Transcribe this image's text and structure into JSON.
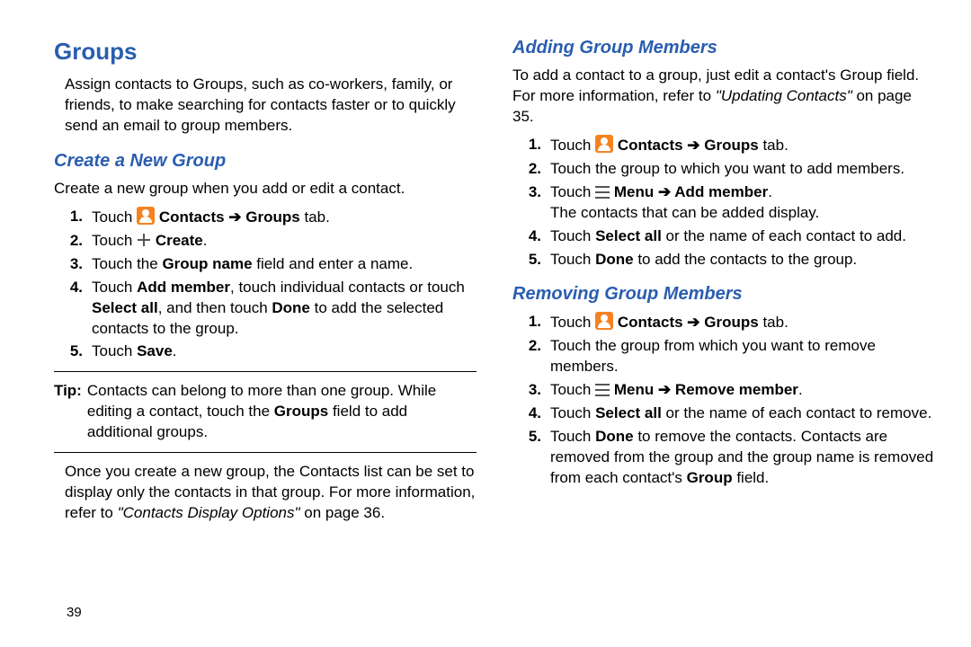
{
  "left": {
    "h1": "Groups",
    "intro": "Assign contacts to Groups, such as co-workers, family, or friends, to make searching for contacts faster or to quickly send an email to group members.",
    "h2a": "Create a New Group",
    "createIntro": "Create a new group when you add or edit a contact.",
    "step1_a": "Touch ",
    "step1_b": "Contacts",
    "step1_arrow": " ➔ ",
    "step1_c": "Groups",
    "step1_d": " tab.",
    "step2_a": "Touch ",
    "step2_b": "Create",
    "step2_c": ".",
    "step3_a": "Touch the ",
    "step3_b": "Group name",
    "step3_c": " field and enter a name.",
    "step4_a": "Touch ",
    "step4_b": "Add member",
    "step4_c": ", touch individual contacts or touch ",
    "step4_d": "Select all",
    "step4_e": ", and then touch ",
    "step4_f": "Done",
    "step4_g": " to add the selected contacts to the group.",
    "step5_a": "Touch ",
    "step5_b": "Save",
    "step5_c": ".",
    "tipLabel": "Tip:",
    "tipText_a": "Contacts can belong to more than one group. While editing a contact, touch the ",
    "tipText_b": "Groups",
    "tipText_c": " field to add additional groups.",
    "closing_a": "Once you create a new group, the Contacts list can be set to display only the contacts in that group. For more information, refer to ",
    "closing_b": "\"Contacts Display Options\"",
    "closing_c": " on page 36.",
    "pageno": "39"
  },
  "right": {
    "h2a": "Adding Group Members",
    "addIntro_a": "To add a contact to a group, just edit a contact's Group field. For more information, refer to ",
    "addIntro_b": "\"Updating Contacts\"",
    "addIntro_c": " on page 35.",
    "a1_a": "Touch ",
    "a1_b": "Contacts",
    "a1_arrow": " ➔ ",
    "a1_c": "Groups",
    "a1_d": " tab.",
    "a2": "Touch the group to which you want to add members.",
    "a3_a": "Touch ",
    "a3_b": "Menu",
    "a3_arrow": " ➔ ",
    "a3_c": "Add member",
    "a3_d": ".",
    "a3_e": "The contacts that can be added display.",
    "a4_a": "Touch ",
    "a4_b": "Select all",
    "a4_c": " or the name of each contact to add.",
    "a5_a": "Touch ",
    "a5_b": "Done",
    "a5_c": " to add the contacts to the group.",
    "h2b": "Removing Group Members",
    "r1_a": "Touch ",
    "r1_b": "Contacts",
    "r1_arrow": " ➔ ",
    "r1_c": "Groups",
    "r1_d": " tab.",
    "r2": "Touch the group from which you want to remove members.",
    "r3_a": "Touch ",
    "r3_b": "Menu",
    "r3_arrow": " ➔ ",
    "r3_c": "Remove member",
    "r3_d": ".",
    "r4_a": "Touch ",
    "r4_b": "Select all",
    "r4_c": " or the name of each contact to remove.",
    "r5_a": "Touch ",
    "r5_b": "Done",
    "r5_c": " to remove the contacts. Contacts are removed from the group and the group name is removed from each contact's ",
    "r5_d": "Group",
    "r5_e": " field."
  }
}
